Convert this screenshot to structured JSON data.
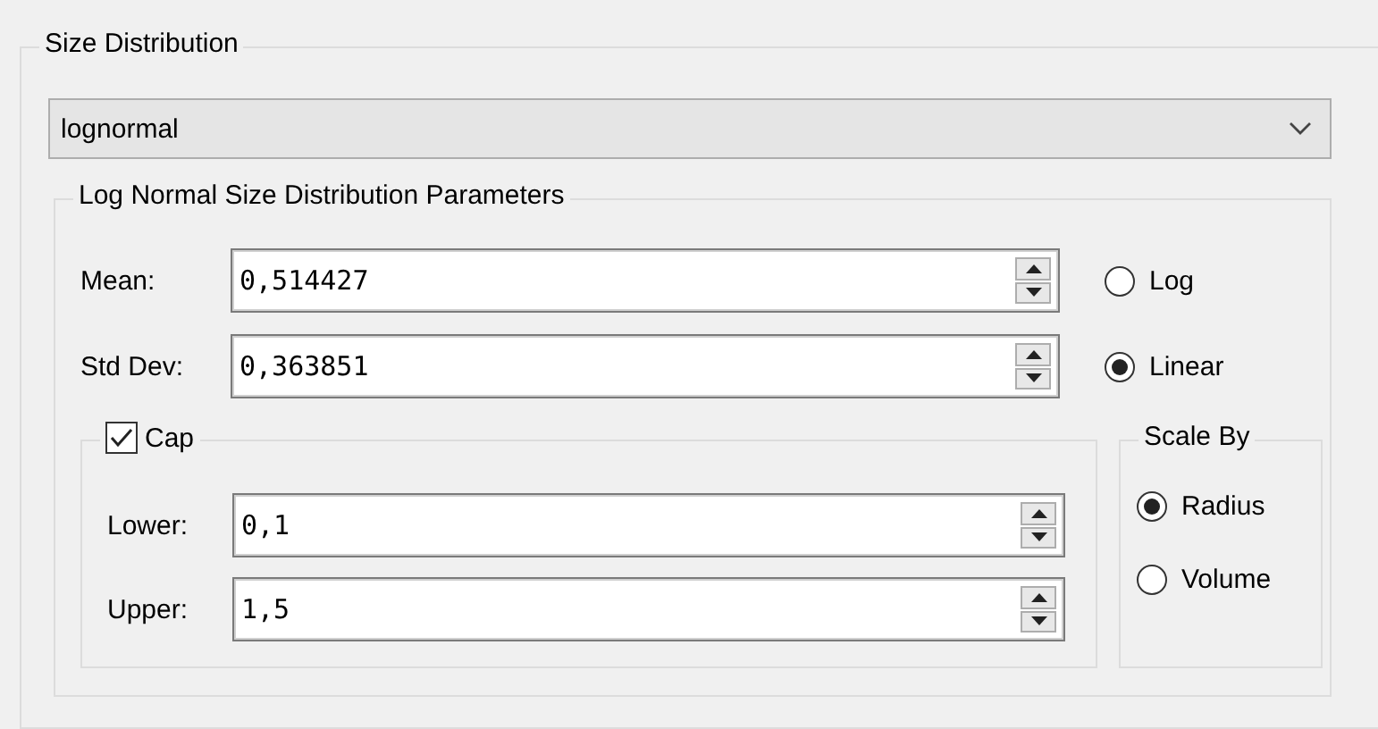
{
  "group": {
    "title": "Size Distribution"
  },
  "distribution": {
    "value": "lognormal"
  },
  "parameters": {
    "title": "Log Normal Size Distribution Parameters",
    "fields": [
      {
        "label": "Mean:",
        "value": "0,514427"
      },
      {
        "label": "Std Dev:",
        "value": "0,363851"
      }
    ],
    "scale_options": [
      {
        "label": "Log",
        "selected": false
      },
      {
        "label": "Linear",
        "selected": true
      }
    ],
    "cap": {
      "label": "Cap",
      "checked": true,
      "fields": [
        {
          "label": "Lower:",
          "value": "0,1"
        },
        {
          "label": "Upper:",
          "value": "1,5"
        }
      ]
    },
    "scale_by": {
      "title": "Scale By",
      "options": [
        {
          "label": "Radius",
          "selected": true
        },
        {
          "label": "Volume",
          "selected": false
        }
      ]
    }
  }
}
